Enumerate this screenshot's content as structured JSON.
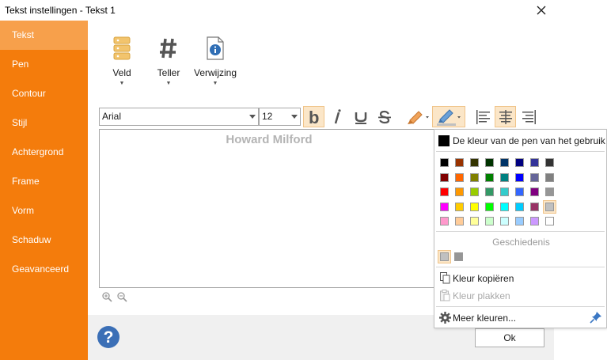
{
  "window": {
    "title": "Tekst instellingen - Tekst 1"
  },
  "sidebar": {
    "items": [
      {
        "label": "Tekst",
        "active": true
      },
      {
        "label": "Pen"
      },
      {
        "label": "Contour"
      },
      {
        "label": "Stijl"
      },
      {
        "label": "Achtergrond"
      },
      {
        "label": "Frame"
      },
      {
        "label": "Vorm"
      },
      {
        "label": "Schaduw"
      },
      {
        "label": "Geavanceerd"
      }
    ]
  },
  "toolbar": {
    "veld_label": "Veld",
    "teller_label": "Teller",
    "verwijzing_label": "Verwijzing",
    "font_family": "Arial",
    "font_size": "12"
  },
  "editor": {
    "text": "Howard Milford"
  },
  "footer": {
    "ok_label": "Ok"
  },
  "color_popup": {
    "pen_color_label": "De kleur van de pen van het gebruik",
    "history_label": "Geschiedenis",
    "copy_label": "Kleur kopiëren",
    "paste_label": "Kleur plakken",
    "more_label": "Meer kleuren...",
    "palette": [
      [
        "#000000",
        "#993300",
        "#333300",
        "#003300",
        "#003366",
        "#000080",
        "#333399",
        "#333333"
      ],
      [
        "#800000",
        "#ff6600",
        "#808000",
        "#008000",
        "#008080",
        "#0000ff",
        "#666699",
        "#808080"
      ],
      [
        "#ff0000",
        "#ff9900",
        "#99cc00",
        "#339966",
        "#33cccc",
        "#3366ff",
        "#800080",
        "#969696"
      ],
      [
        "#ff00ff",
        "#ffcc00",
        "#ffff00",
        "#00ff00",
        "#00ffff",
        "#00ccff",
        "#993366",
        "#c0c0c0"
      ],
      [
        "#ff99cc",
        "#ffcc99",
        "#ffff99",
        "#ccffcc",
        "#ccffff",
        "#99ccff",
        "#cc99ff",
        "#ffffff"
      ]
    ],
    "history": [
      "#c0c0c0",
      "#969696"
    ]
  },
  "colors": {
    "accent": "#f47c0c",
    "accent_active": "#f7a04b",
    "selection": "#fbe6c8"
  }
}
